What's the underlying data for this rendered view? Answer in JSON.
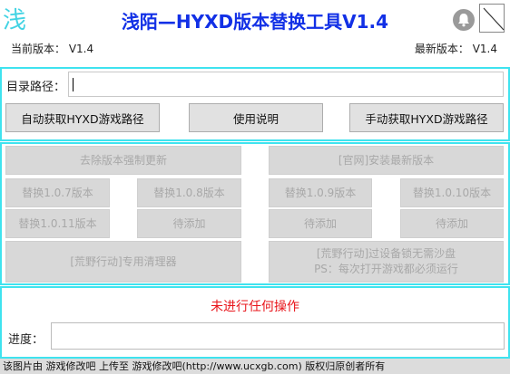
{
  "header": {
    "logo_char": "浅",
    "title": "浅陌—HYXD版本替换工具V1.4"
  },
  "versions": {
    "current": "当前版本： V1.4",
    "latest": "最新版本： V1.4"
  },
  "directory": {
    "label": "目录路径：",
    "value": ""
  },
  "actions": {
    "auto_path": "自动获取HYXD游戏路径",
    "help": "使用说明",
    "manual_path": "手动获取HYXD游戏路径"
  },
  "operations": {
    "remove_force_update": "去除版本强制更新",
    "install_latest": "[官网]安装最新版本",
    "replace_107": "替换1.0.7版本",
    "replace_108": "替换1.0.8版本",
    "replace_109": "替换1.0.9版本",
    "replace_1010": "替换1.0.10版本",
    "replace_1011": "替换1.0.11版本",
    "pending_1": "待添加",
    "pending_2": "待添加",
    "pending_3": "待添加",
    "cleaner": "[荒野行动]专用清理器",
    "bypass_line1": "[荒野行动]过设备锁无需沙盘",
    "bypass_line2": "PS：每次打开游戏都必须运行"
  },
  "status": {
    "message": "未进行任何操作",
    "progress_label": "进度：",
    "progress": 0
  },
  "footer": {
    "text": "该图片由 游戏修改吧 上传至 游戏修改吧(http://www.ucxgb.com) 版权归原创者所有"
  },
  "colors": {
    "accent_cyan": "#3fe3ef",
    "title_blue": "#1230e6",
    "status_red": "#e8141a"
  },
  "icons": {
    "bell": "bell-icon",
    "close": "close-icon"
  }
}
